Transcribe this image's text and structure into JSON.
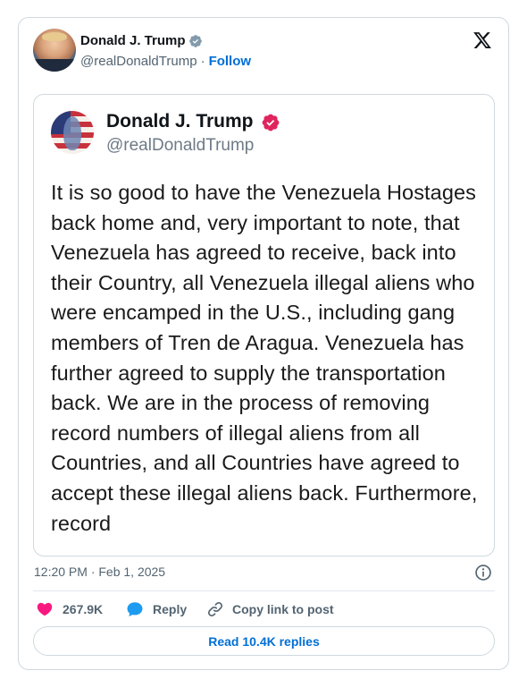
{
  "author": {
    "name": "Donald J. Trump",
    "handle": "@realDonaldTrump",
    "separator": "·",
    "follow_label": "Follow"
  },
  "embedded_post": {
    "name": "Donald J. Trump",
    "handle": "@realDonaldTrump",
    "text": "It is so good to have the Venezuela Hostages back home and, very important to note, that Venezuela has agreed to receive, back into their Country, all Venezuela illegal aliens who were encamped in the U.S., including gang members of Tren de Aragua. Venezuela has further agreed to supply the transportation back. We are in the process of removing record numbers of illegal aliens from all Countries, and all Countries have agreed to accept these illegal aliens back. Furthermore, record"
  },
  "meta": {
    "timestamp": "12:20 PM · Feb 1, 2025"
  },
  "actions": {
    "like_count": "267.9K",
    "reply_label": "Reply",
    "copy_label": "Copy link to post",
    "read_replies_label": "Read 10.4K replies"
  },
  "colors": {
    "link_blue": "#006fd6",
    "like_pink": "#f91880",
    "reply_blue": "#1d9bf0",
    "verified_gray": "#829aab",
    "verified_pink": "#e0245e"
  },
  "icons": {
    "platform": "x-logo-icon",
    "verified": "verified-badge-icon",
    "like": "heart-icon",
    "reply": "speech-bubble-icon",
    "copy": "link-icon",
    "info": "info-icon"
  }
}
